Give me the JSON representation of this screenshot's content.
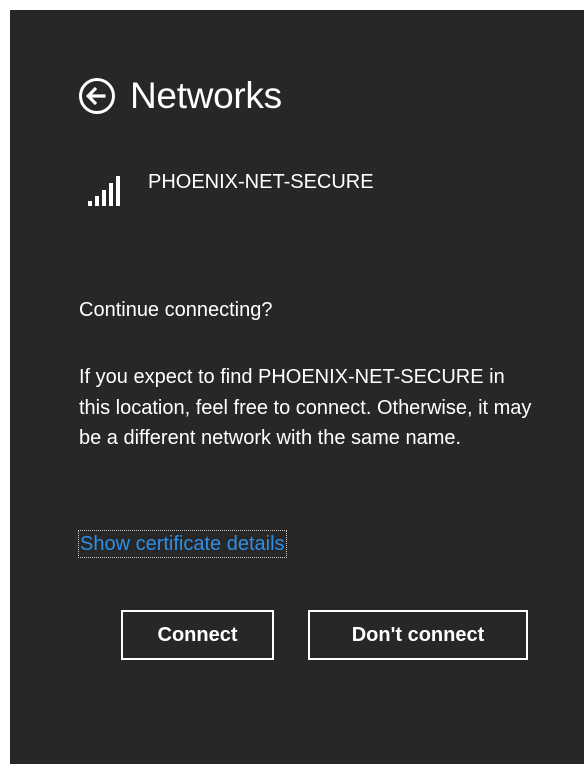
{
  "header": {
    "back_icon": "back-arrow-circle-icon",
    "title": "Networks"
  },
  "network": {
    "signal_icon": "wifi-signal-bars-icon",
    "signal_bars_filled": 5,
    "signal_bars_total": 5,
    "name": "PHOENIX-NET-SECURE"
  },
  "dialog": {
    "prompt": "Continue connecting?",
    "message": "If you expect to find PHOENIX-NET-SECURE in this location, feel free to connect. Otherwise, it may be a different network with the same name.",
    "certificate_link": "Show certificate details"
  },
  "buttons": {
    "connect_label": "Connect",
    "dont_connect_label": "Don't connect"
  },
  "colors": {
    "background": "#272727",
    "text": "#ffffff",
    "link": "#2f8fe6"
  }
}
